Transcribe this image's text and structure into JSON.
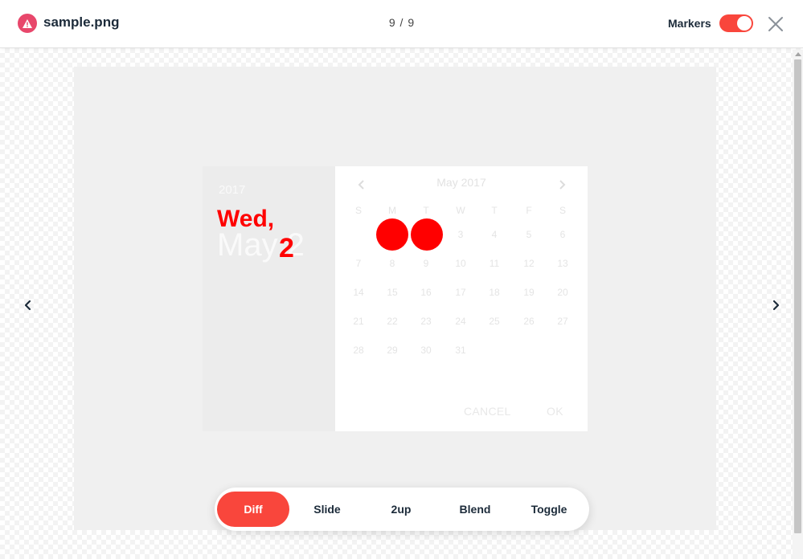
{
  "header": {
    "file_name": "sample.png",
    "counter": "9 / 9",
    "markers_label": "Markers",
    "markers_on": true,
    "warning_icon": "warning-triangle-icon",
    "close_icon": "close-icon"
  },
  "dialog": {
    "year": "2017",
    "day_label": "May 2",
    "month_title": "May 2017",
    "weekdays": [
      "S",
      "M",
      "T",
      "W",
      "T",
      "F",
      "S"
    ],
    "weeks": [
      [
        "",
        "1",
        "2",
        "3",
        "4",
        "5",
        "6"
      ],
      [
        "7",
        "8",
        "9",
        "10",
        "11",
        "12",
        "13"
      ],
      [
        "14",
        "15",
        "16",
        "17",
        "18",
        "19",
        "20"
      ],
      [
        "21",
        "22",
        "23",
        "24",
        "25",
        "26",
        "27"
      ],
      [
        "28",
        "29",
        "30",
        "31",
        "",
        "",
        ""
      ]
    ],
    "cancel_label": "CANCEL",
    "ok_label": "OK"
  },
  "diff_overlay": {
    "text_top": "Wed,",
    "text_bottom": "2"
  },
  "tabs": [
    {
      "label": "Diff",
      "active": true
    },
    {
      "label": "Slide",
      "active": false
    },
    {
      "label": "2up",
      "active": false
    },
    {
      "label": "Blend",
      "active": false
    },
    {
      "label": "Toggle",
      "active": false
    }
  ],
  "colors": {
    "accent": "#f9463c",
    "warning": "#e8476b",
    "diff": "#ff0000",
    "text_dark": "#1c2b3a"
  }
}
